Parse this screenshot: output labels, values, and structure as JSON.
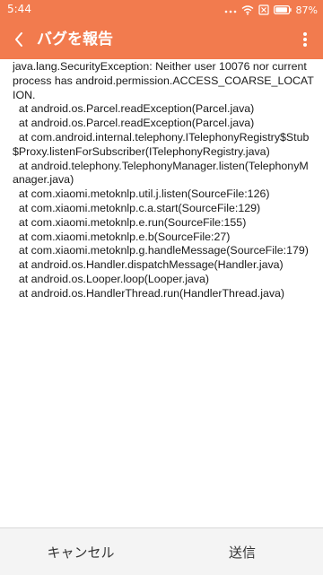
{
  "status_bar": {
    "time": "5:44",
    "battery": "87%"
  },
  "app_bar": {
    "title": "バグを報告"
  },
  "report": {
    "stack_trace": "java.lang.SecurityException: Neither user 10076 nor current process has android.permission.ACCESS_COARSE_LOCATION.\n  at android.os.Parcel.readException(Parcel.java)\n  at android.os.Parcel.readException(Parcel.java)\n  at com.android.internal.telephony.ITelephonyRegistry$Stub$Proxy.listenForSubscriber(ITelephonyRegistry.java)\n  at android.telephony.TelephonyManager.listen(TelephonyManager.java)\n  at com.xiaomi.metoknlp.util.j.listen(SourceFile:126)\n  at com.xiaomi.metoknlp.c.a.start(SourceFile:129)\n  at com.xiaomi.metoknlp.e.run(SourceFile:155)\n  at com.xiaomi.metoknlp.e.b(SourceFile:27)\n  at com.xiaomi.metoknlp.g.handleMessage(SourceFile:179)\n  at android.os.Handler.dispatchMessage(Handler.java)\n  at android.os.Looper.loop(Looper.java)\n  at android.os.HandlerThread.run(HandlerThread.java)"
  },
  "actions": {
    "cancel_label": "キャンセル",
    "send_label": "送信"
  },
  "colors": {
    "accent": "#f27b4e",
    "bottom_bar": "#f4f4f4"
  },
  "icons": [
    "back-arrow-icon",
    "more-vert-icon",
    "dots-icon",
    "wifi-icon",
    "sim-off-icon",
    "battery-icon"
  ]
}
